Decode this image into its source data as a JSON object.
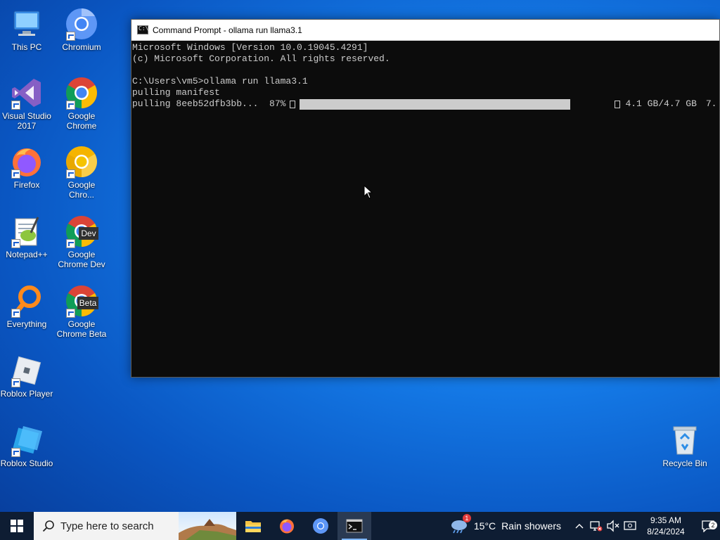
{
  "desktop": {
    "icons": [
      {
        "label": "This PC"
      },
      {
        "label": "Chromium"
      },
      {
        "label": "Visual Studio 2017"
      },
      {
        "label": "Google Chrome"
      },
      {
        "label": "Firefox"
      },
      {
        "label": "Google Chro..."
      },
      {
        "label": "Notepad++"
      },
      {
        "label": "Google Chrome Dev"
      },
      {
        "label": "Everything"
      },
      {
        "label": "Google Chrome Beta"
      },
      {
        "label": "Roblox Player"
      },
      {
        "label": "Roblox Studio"
      },
      {
        "label": "Recycle Bin"
      }
    ],
    "badges": {
      "dev": "Dev",
      "beta": "Beta"
    }
  },
  "cmd": {
    "title": "Command Prompt - ollama  run llama3.1",
    "lines": [
      "Microsoft Windows [Version 10.0.19045.4291]",
      "(c) Microsoft Corporation. All rights reserved.",
      "",
      "C:\\Users\\vm5>ollama run llama3.1",
      "pulling manifest"
    ],
    "progress": {
      "prefix": "pulling 8eeb52dfb3bb...  ",
      "percent": "87%",
      "fraction": 0.87,
      "size": "4.1 GB/4.7 GB",
      "rate": "7."
    }
  },
  "taskbar": {
    "search_placeholder": "Type here to search",
    "weather_temp": "15°C",
    "weather_desc": "Rain showers",
    "weather_badge": "1",
    "time": "9:35 AM",
    "date": "8/24/2024",
    "notification_count": "2"
  },
  "colors": {
    "console_bg": "#0c0c0c",
    "console_text": "#cccccc",
    "taskbar_bg": "#0e1d33"
  }
}
